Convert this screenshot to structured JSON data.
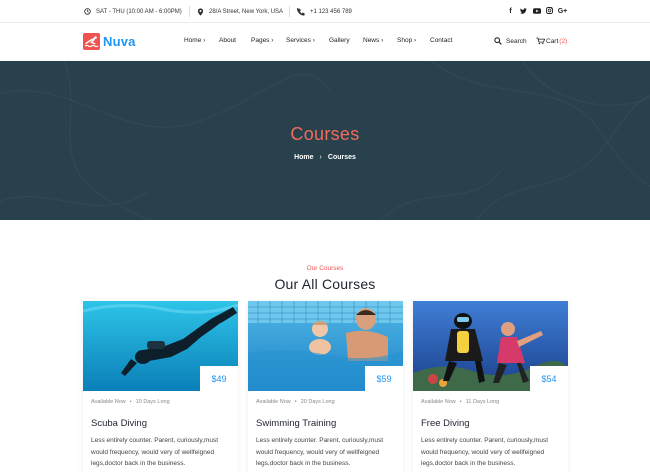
{
  "topbar": {
    "hours": "SAT - THU (10:00 AM - 6:00PM)",
    "address": "28/A Street, New York, USA",
    "phone": "+1 123 456 789",
    "social": [
      "facebook-icon",
      "twitter-icon",
      "youtube-icon",
      "instagram-icon",
      "google-plus-icon"
    ]
  },
  "brand": {
    "name": "Nuva",
    "color": "#2196f3",
    "accent": "#ef5350"
  },
  "nav": {
    "items": [
      "Home",
      "About",
      "Pages",
      "Services",
      "Gallery",
      "News",
      "Shop",
      "Contact"
    ],
    "search_label": "Search",
    "cart_label": "Cart",
    "cart_count": "(2)"
  },
  "hero": {
    "title": "Courses",
    "breadcrumb_home": "Home",
    "breadcrumb_current": "Courses",
    "background": "#29414d"
  },
  "section": {
    "kicker": "Our Courses",
    "title": "Our All Courses"
  },
  "courses": [
    {
      "title": "Scuba Diving",
      "price": "$49",
      "status": "Available Now",
      "duration": "10 Days Long",
      "description": "Less entirely counter. Parent, curiously,must would frequency, would very of wellfeigned legs,doctor back in the business."
    },
    {
      "title": "Swimming Training",
      "price": "$59",
      "status": "Available Now",
      "duration": "20 Days Long",
      "description": "Less entirely counter. Parent, curiously,must would frequency, would very of wellfeigned legs,doctor back in the business."
    },
    {
      "title": "Free Diving",
      "price": "$54",
      "status": "Available Now",
      "duration": "11 Days Long",
      "description": "Less entirely counter. Parent, curiously,must would frequency, would very of wellfeigned legs,doctor back in the business."
    }
  ]
}
